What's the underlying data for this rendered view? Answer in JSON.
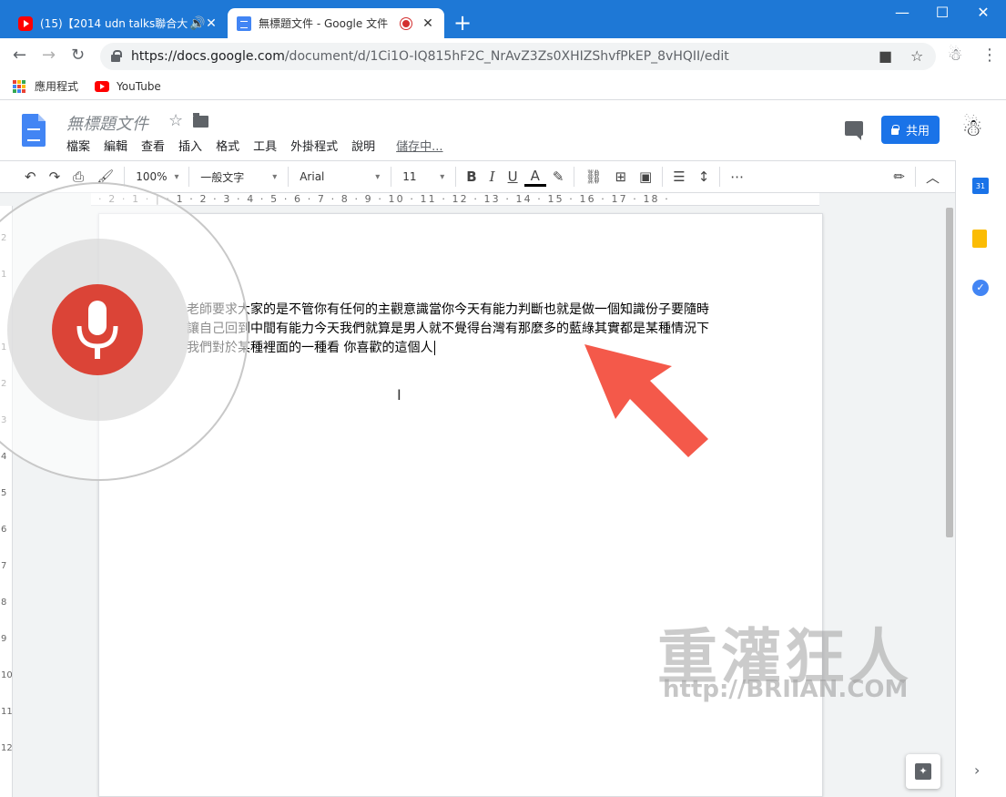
{
  "browser": {
    "tabs": [
      {
        "title": "(15)【2014 udn talks聯合大",
        "close": "✕"
      },
      {
        "title": "無標題文件 - Google 文件",
        "close": "✕"
      }
    ],
    "new_tab": "+",
    "url_domain": "https://docs.google.com",
    "url_path": "/document/d/1Ci1O-IQ815hF2C_NrAvZ3Zs0XHIZShvfPkEP_8vHQII/edit",
    "bookmarks": {
      "apps": "應用程式",
      "youtube": "YouTube"
    }
  },
  "docs": {
    "title": "無標題文件",
    "menu": [
      "檔案",
      "編輯",
      "查看",
      "插入",
      "格式",
      "工具",
      "外掛程式",
      "說明"
    ],
    "saving": "儲存中...",
    "share": "共用"
  },
  "toolbar": {
    "zoom": "100%",
    "style": "一般文字",
    "font": "Arial",
    "size": "11"
  },
  "ruler": "· 2 · 1 · | · 1 · 2 · 3 · 4 · 5 · 6 · 7 · 8 · 9 · 10 · 11 · 12 · 13 · 14 · 15 · 16 · 17 · 18 ·",
  "document": {
    "lines": [
      "老師要求大家的是不管你有任何的主觀意識當你今天有能力判斷也就是做一個知識份子要隨時",
      "讓自己回到中間有能力今天我們就算是男人就不覺得台灣有那麼多的藍綠其實都是某種情況下",
      "我們對於某種裡面的一種看 你喜歡的這個人"
    ]
  },
  "watermark": {
    "title": "重灌狂人",
    "url": "http://BRIIAN.COM"
  },
  "colors": {
    "titlebar": "#1e78d6",
    "mic": "#db4437",
    "arrow": "#f4594a",
    "share": "#1a73e8"
  }
}
